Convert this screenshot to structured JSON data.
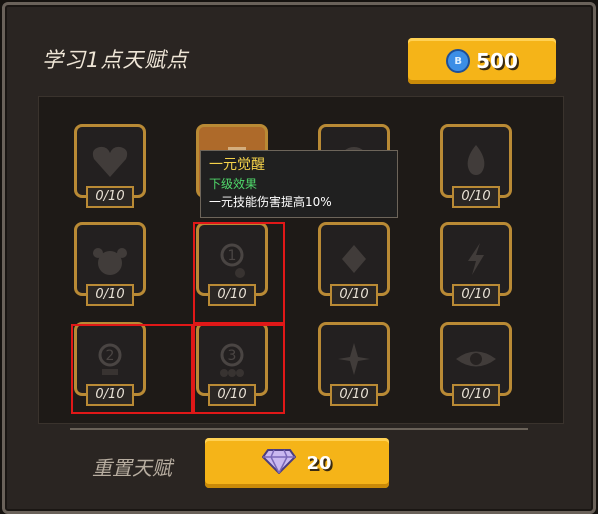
{
  "header": {
    "title": "学习1点天赋点",
    "currency_amount": "500",
    "currency_icon": "blue-coin-icon"
  },
  "talents": [
    {
      "count": "0/10",
      "icon": "heart-icon"
    },
    {
      "count": "",
      "icon": "book-icon"
    },
    {
      "count": "",
      "icon": "swirl-icon"
    },
    {
      "count": "0/10",
      "icon": "flame-icon"
    },
    {
      "count": "0/10",
      "icon": "potion-icon"
    },
    {
      "count": "0/10",
      "icon": "number-1-icon"
    },
    {
      "count": "0/10",
      "icon": "shield-icon"
    },
    {
      "count": "0/10",
      "icon": "lightning-icon"
    },
    {
      "count": "0/10",
      "icon": "number-2-icon"
    },
    {
      "count": "0/10",
      "icon": "number-3-icon"
    },
    {
      "count": "0/10",
      "icon": "spike-icon"
    },
    {
      "count": "0/10",
      "icon": "eye-icon"
    }
  ],
  "tooltip": {
    "name": "一元觉醒",
    "subtitle": "下级效果",
    "effect": "一元技能伤害提高10%"
  },
  "reset": {
    "label": "重置天赋",
    "cost": "20",
    "icon": "diamond-icon"
  },
  "colors": {
    "gold_button": "#f5b418",
    "frame_gold": "#b98a35",
    "highlight_red": "#e01818",
    "tooltip_green": "#4fd86a",
    "tooltip_title": "#f5d24a"
  }
}
